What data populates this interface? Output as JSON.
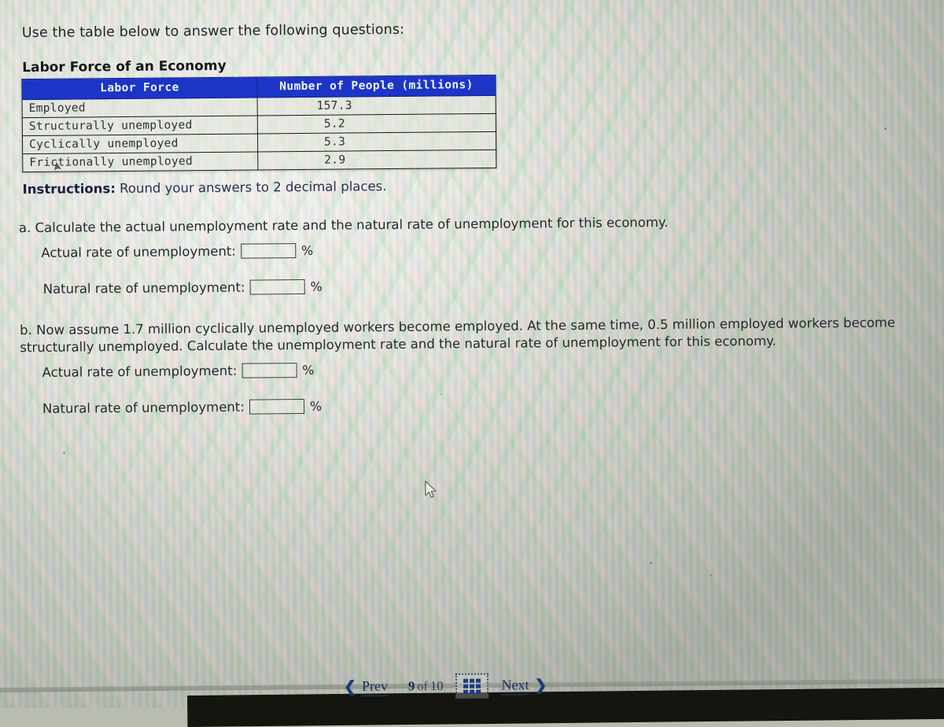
{
  "page": {
    "intro": "Use the table below to answer the following questions:",
    "table_title": "Labor Force of an Economy"
  },
  "table": {
    "headers": [
      "Labor Force",
      "Number of People (millions)"
    ],
    "rows": [
      {
        "label": "Employed",
        "value": "157.3"
      },
      {
        "label": "Structurally unemployed",
        "value": "5.2"
      },
      {
        "label": "Cyclically unemployed",
        "value": "5.3"
      },
      {
        "label": "Frictionally unemployed",
        "value": "2.9"
      }
    ]
  },
  "instructions": {
    "bold_prefix": "Instructions:",
    "text": " Round your answers to 2 decimal places."
  },
  "questions": [
    {
      "id": "a",
      "prompt": "a. Calculate the actual unemployment rate and the natural rate of unemployment for this economy.",
      "fields": [
        {
          "label": "Actual rate of unemployment:",
          "value": "",
          "unit": "%"
        },
        {
          "label": "Natural rate of unemployment:",
          "value": "",
          "unit": "%"
        }
      ]
    },
    {
      "id": "b",
      "prompt": "b. Now assume 1.7 million cyclically unemployed workers become employed. At the same time, 0.5 million employed workers become structurally unemployed. Calculate the unemployment rate and the natural rate of unemployment for this economy.",
      "fields": [
        {
          "label": "Actual rate of unemployment:",
          "value": "",
          "unit": "%"
        },
        {
          "label": "Natural rate of unemployment:",
          "value": "",
          "unit": "%"
        }
      ]
    }
  ],
  "nav": {
    "prev_label": "Prev",
    "next_label": "Next",
    "current_page": "9",
    "of_word": "of",
    "total_pages": "10",
    "grid_icon": "grid-3x3-icon",
    "prev_icon": "chevron-left-icon",
    "next_icon": "chevron-right-icon"
  },
  "colors": {
    "header_blue": "#1d35c7",
    "instruction_navy": "#2b2e55",
    "nav_blue": "#1d2b63",
    "screen_bg": "#e2e6da"
  }
}
